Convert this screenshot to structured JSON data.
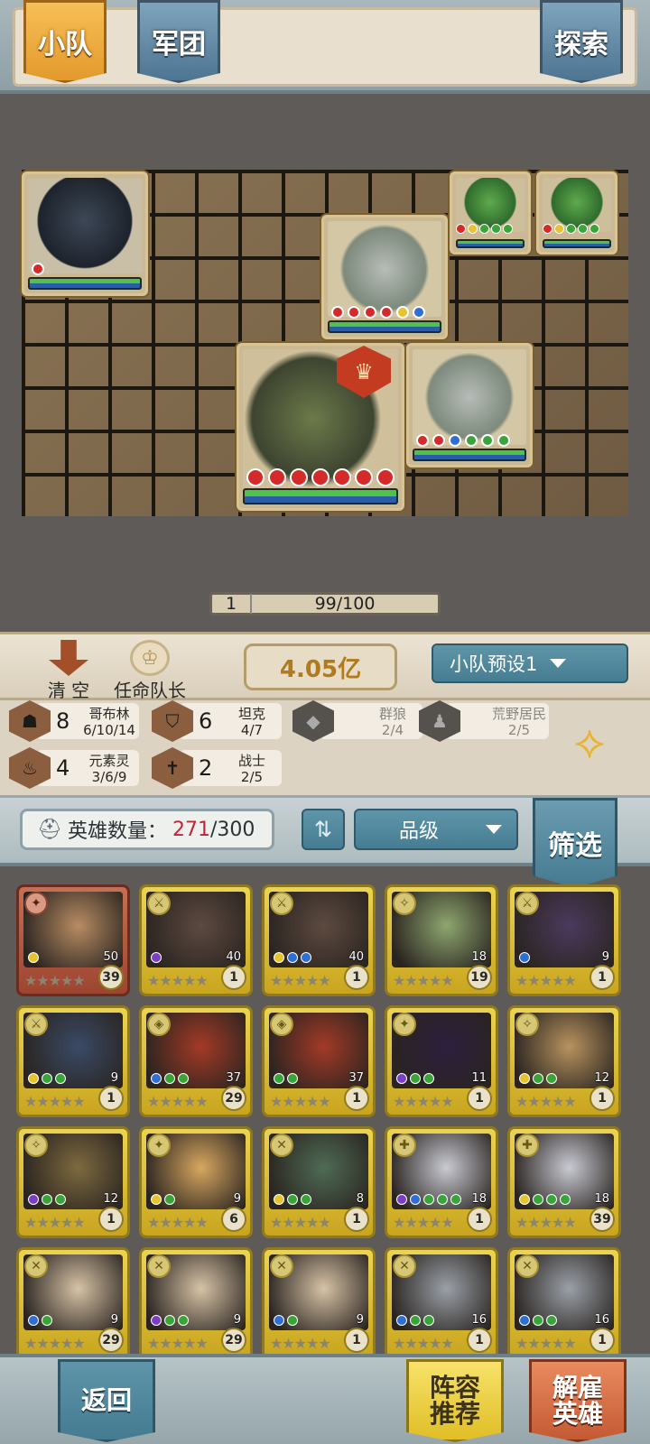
{
  "tabs": [
    {
      "label": "小队",
      "active": true
    },
    {
      "label": "军团",
      "active": false
    },
    {
      "label": "探索",
      "active": false
    }
  ],
  "board": {
    "leader_badge_icon": "shield-crest-icon",
    "units": [
      {
        "name": "dire-wolf",
        "colors": [
          "red"
        ]
      },
      {
        "name": "goblin-brute-1",
        "colors": [
          "red",
          "yellow",
          "green",
          "green",
          "green"
        ]
      },
      {
        "name": "goblin-brute-2",
        "colors": [
          "red",
          "yellow",
          "green",
          "green",
          "green"
        ]
      },
      {
        "name": "stone-golem-1",
        "colors": [
          "red",
          "red",
          "red",
          "red",
          "yellow",
          "blue"
        ]
      },
      {
        "name": "iron-titan-leader",
        "colors": [
          "red",
          "red",
          "red",
          "red",
          "red",
          "red",
          "red"
        ]
      },
      {
        "name": "stone-golem-2",
        "colors": [
          "red",
          "red",
          "blue",
          "green",
          "green",
          "green"
        ]
      }
    ],
    "progress": {
      "level": "1",
      "value": "99/100"
    }
  },
  "actions": {
    "clear_label": "清 空",
    "appoint_label": "任命队长",
    "power": "4.05亿",
    "preset_label": "小队预设1"
  },
  "synergies": [
    {
      "count": "8",
      "name": "哥布林",
      "progress": "6/10/14",
      "icon": "goblin-icon",
      "active": true
    },
    {
      "count": "6",
      "name": "坦克",
      "progress": "4/7",
      "icon": "shield-icon",
      "active": true
    },
    {
      "count": "",
      "name": "群狼",
      "progress": "2/4",
      "icon": "wolf-icon",
      "active": false
    },
    {
      "count": "",
      "name": "荒野居民",
      "progress": "2/5",
      "icon": "wild-folk-icon",
      "active": false
    },
    {
      "count": "4",
      "name": "元素灵",
      "progress": "3/6/9",
      "icon": "elemental-icon",
      "active": true
    },
    {
      "count": "2",
      "name": "战士",
      "progress": "2/5",
      "icon": "sword-icon",
      "active": true
    }
  ],
  "roster": {
    "count_label": "英雄数量：",
    "count_current": "271",
    "count_max": "/300",
    "sort_label": "⇅",
    "grade_label": "品级",
    "filter_label": "筛选"
  },
  "heroes": [
    {
      "type": "red",
      "cls": "✦",
      "cost": "50",
      "level": "39",
      "colors": [
        "yellow"
      ],
      "portrait": "#b88c63"
    },
    {
      "type": "gold",
      "cls": "⚔",
      "cost": "40",
      "level": "1",
      "colors": [
        "purple"
      ],
      "portrait": "#5d4a40"
    },
    {
      "type": "gold",
      "cls": "⚔",
      "cost": "40",
      "level": "1",
      "colors": [
        "yellow",
        "blue",
        "blue"
      ],
      "portrait": "#5d4a40"
    },
    {
      "type": "gold",
      "cls": "✧",
      "cost": "18",
      "level": "19",
      "colors": [],
      "portrait": "#8ea66f"
    },
    {
      "type": "gold",
      "cls": "⚔",
      "cost": "9",
      "level": "1",
      "colors": [
        "blue"
      ],
      "portrait": "#4b3a5e"
    },
    {
      "type": "gold",
      "cls": "⚔",
      "cost": "9",
      "level": "1",
      "colors": [
        "yellow",
        "green",
        "green"
      ],
      "portrait": "#3a4a66"
    },
    {
      "type": "gold",
      "cls": "◈",
      "cost": "37",
      "level": "29",
      "colors": [
        "blue",
        "green",
        "green"
      ],
      "portrait": "#a33a26"
    },
    {
      "type": "gold",
      "cls": "◈",
      "cost": "37",
      "level": "1",
      "colors": [
        "green",
        "green"
      ],
      "portrait": "#a33a26"
    },
    {
      "type": "gold",
      "cls": "✦",
      "cost": "11",
      "level": "1",
      "colors": [
        "purple",
        "green",
        "green"
      ],
      "portrait": "#2c1f3e"
    },
    {
      "type": "gold",
      "cls": "✧",
      "cost": "12",
      "level": "1",
      "colors": [
        "yellow",
        "green",
        "green"
      ],
      "portrait": "#b8935f"
    },
    {
      "type": "gold",
      "cls": "✧",
      "cost": "12",
      "level": "1",
      "colors": [
        "purple",
        "green",
        "green"
      ],
      "portrait": "#7d6a3f"
    },
    {
      "type": "gold",
      "cls": "✦",
      "cost": "9",
      "level": "6",
      "colors": [
        "yellow",
        "green"
      ],
      "portrait": "#d8a760"
    },
    {
      "type": "gold",
      "cls": "✕",
      "cost": "8",
      "level": "1",
      "colors": [
        "yellow",
        "green",
        "green"
      ],
      "portrait": "#4f6b55"
    },
    {
      "type": "gold",
      "cls": "✚",
      "cost": "18",
      "level": "1",
      "colors": [
        "purple",
        "blue",
        "green",
        "green",
        "green"
      ],
      "portrait": "#c9cad3"
    },
    {
      "type": "gold",
      "cls": "✚",
      "cost": "18",
      "level": "39",
      "colors": [
        "yellow",
        "green",
        "green",
        "green"
      ],
      "portrait": "#c9cad3"
    },
    {
      "type": "gold",
      "cls": "✕",
      "cost": "9",
      "level": "29",
      "colors": [
        "blue",
        "green"
      ],
      "portrait": "#d7c3a6"
    },
    {
      "type": "gold",
      "cls": "✕",
      "cost": "9",
      "level": "29",
      "colors": [
        "purple",
        "green",
        "green"
      ],
      "portrait": "#d7c3a6"
    },
    {
      "type": "gold",
      "cls": "✕",
      "cost": "9",
      "level": "1",
      "colors": [
        "blue",
        "green"
      ],
      "portrait": "#d7c3a6"
    },
    {
      "type": "gold",
      "cls": "✕",
      "cost": "16",
      "level": "1",
      "colors": [
        "blue",
        "green",
        "green"
      ],
      "portrait": "#9aa0a8"
    },
    {
      "type": "gold",
      "cls": "✕",
      "cost": "16",
      "level": "1",
      "colors": [
        "blue",
        "green",
        "green"
      ],
      "portrait": "#9aa0a8"
    }
  ],
  "bottom": {
    "back_label": "返回",
    "recommend_label": "阵容推荐",
    "dismiss_label": "解雇英雄"
  }
}
